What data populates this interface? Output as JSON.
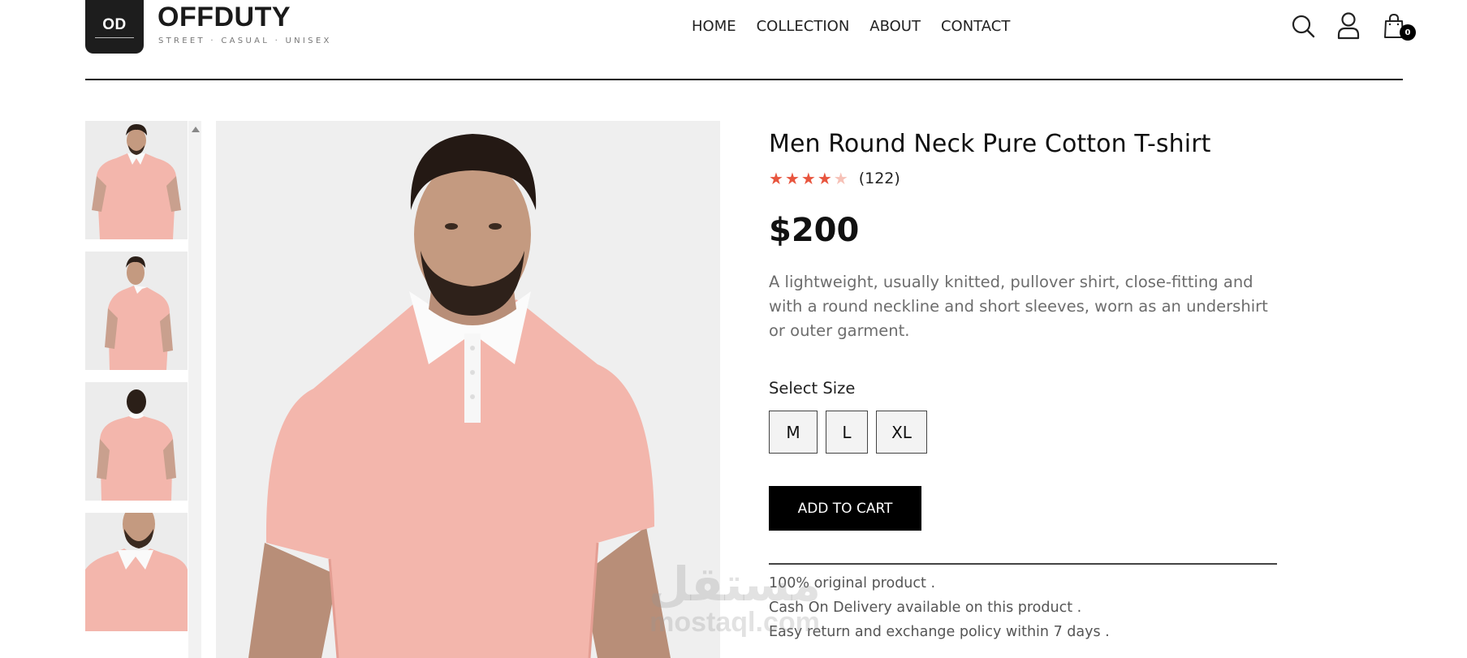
{
  "brand": {
    "badge": "OD",
    "name": "OFFDUTY",
    "tagline": "STREET · CASUAL · UNISEX"
  },
  "nav": [
    "HOME",
    "COLLECTION",
    "ABOUT",
    "CONTACT"
  ],
  "header_icons": [
    "search-icon",
    "user-icon",
    "shopping-bag-icon"
  ],
  "cart": {
    "count": "0"
  },
  "colors": {
    "accent_star": "#e8553e",
    "shirt_pink": "#f3b6ac",
    "button_black": "#000000",
    "description_gray": "#6d6d6d"
  },
  "product": {
    "title": "Men Round Neck Pure Cotton T-shirt",
    "rating": 4,
    "rating_max": 5,
    "reviews": "(122)",
    "price": "$200",
    "description": "A lightweight, usually knitted, pullover shirt, close-fitting and with a round neckline and short sleeves, worn as an undershirt or outer garment.",
    "size_label": "Select Size",
    "sizes": [
      "M",
      "L",
      "XL"
    ],
    "add_to_cart": "ADD TO CART",
    "perks": [
      "100% original product .",
      "Cash On Delivery available on this product .",
      "Easy return and exchange policy within 7 days ."
    ]
  },
  "gallery": {
    "thumbnails": [
      "front view",
      "side view",
      "back view",
      "close-up view"
    ]
  },
  "watermark": {
    "arabic": "مستقل",
    "latin": "mostaql.com"
  }
}
